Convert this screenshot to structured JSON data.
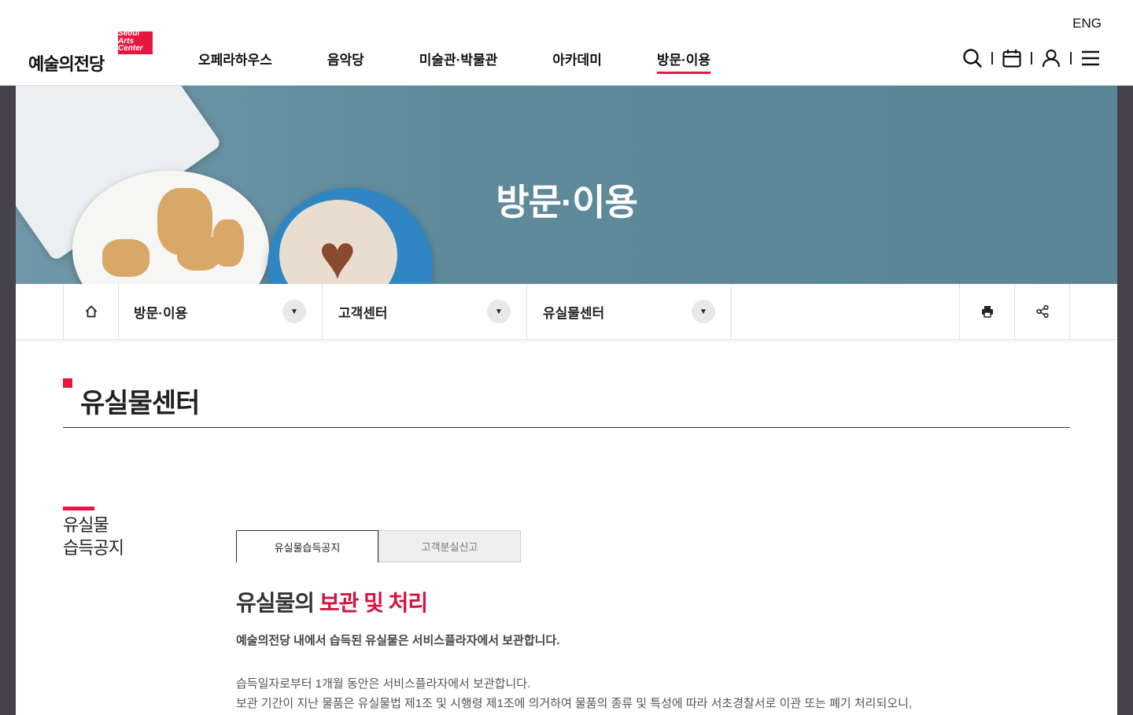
{
  "header": {
    "logo_ko": "예술의전당",
    "logo_en": [
      "Seoul",
      "Arts",
      "Center"
    ],
    "lang_link": "ENG",
    "nav": [
      {
        "label": "오페라하우스",
        "active": false
      },
      {
        "label": "음악당",
        "active": false
      },
      {
        "label": "미술관·박물관",
        "active": false
      },
      {
        "label": "아카데미",
        "active": false
      },
      {
        "label": "방문·이용",
        "active": true
      }
    ],
    "icons": [
      "search-icon",
      "calendar-icon",
      "user-icon",
      "menu-icon"
    ]
  },
  "visual": {
    "title": "방문·이용"
  },
  "location": {
    "home_icon": "home-icon",
    "items": [
      {
        "label": "방문·이용"
      },
      {
        "label": "고객센터"
      },
      {
        "label": "유실물센터"
      }
    ],
    "tools": [
      "print-icon",
      "share-icon"
    ]
  },
  "page": {
    "title": "유실물센터",
    "side_title_line1": "유실물",
    "side_title_line2": "습득공지",
    "tabs": [
      {
        "label": "유실물습득공지",
        "active": true
      },
      {
        "label": "고객분실신고",
        "active": false
      }
    ],
    "section_title_plain": "유실물의 ",
    "section_title_highlight": "보관 및 처리",
    "lead": "예술의전당 내에서 습득된 유실물은 서비스플라자에서 보관합니다.",
    "body": [
      "습득일자로부터 1개월 동안은 서비스플라자에서 보관합니다.",
      "보관 기간이 지난 물품은 유실물법 제1조 및 시행령 제1조에 의거하여 물품의 종류 및 특성에 따라 서초경찰서로 이관 또는 폐기 처리되오니,"
    ]
  },
  "colors": {
    "accent": "#e4173f",
    "highlight_text": "#d41443"
  }
}
